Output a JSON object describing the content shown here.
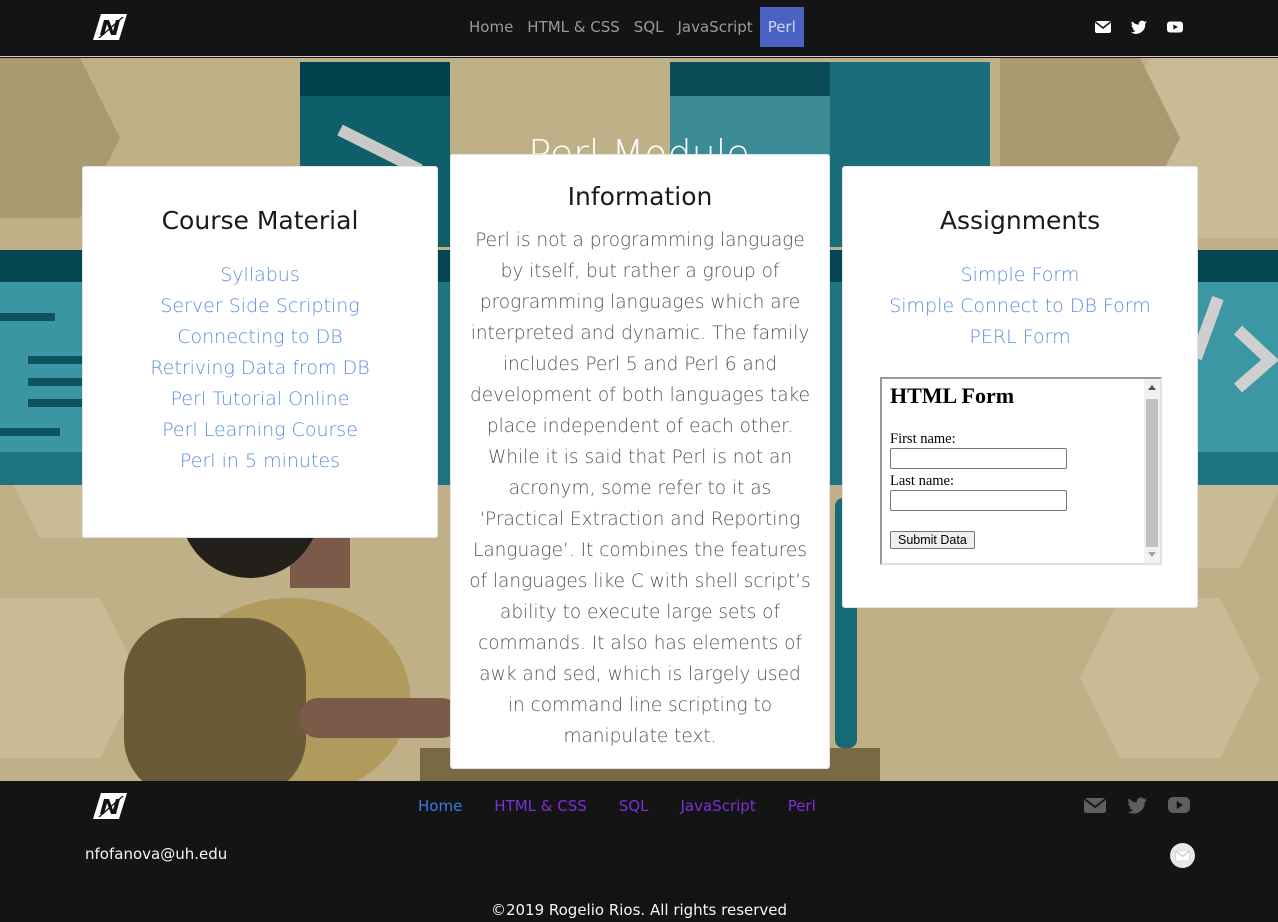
{
  "nav": {
    "logo_icon": "n-slash-logo-icon",
    "links": [
      "Home",
      "HTML & CSS",
      "SQL",
      "JavaScript",
      "Perl"
    ],
    "active": "Perl",
    "social_icons": [
      "envelope-icon",
      "twitter-icon",
      "youtube-icon"
    ]
  },
  "hero": {
    "title": "Perl Module"
  },
  "course_material": {
    "title": "Course Material",
    "links": [
      "Syllabus",
      "Server Side Scripting",
      "Connecting to DB",
      "Retriving Data from DB",
      "Perl Tutorial Online",
      "Perl Learning Course",
      "Perl in 5 minutes"
    ]
  },
  "information": {
    "title": "Information",
    "text": "Perl is not a programming language by itself, but rather a group of programming languages which are interpreted and dynamic. The family includes Perl 5 and Perl 6 and development of both languages take place independent of each other. While it is said that Perl is not an acronym, some refer to it as ‘Practical Extraction and Reporting Language’. It combines the features of languages like C with shell script’s ability to execute large sets of commands. It also has elements of awk and sed, which is largely used in command line scripting to manipulate text."
  },
  "assignments": {
    "title": "Assignments",
    "links": [
      "Simple Form",
      "Simple Connect to DB Form",
      "PERL Form"
    ],
    "form": {
      "heading": "HTML Form",
      "first_name_label": "First name:",
      "first_name_value": "",
      "last_name_label": "Last name:",
      "last_name_value": "",
      "submit_label": "Submit Data"
    }
  },
  "footer": {
    "links": [
      "Home",
      "HTML & CSS",
      "SQL",
      "JavaScript",
      "Perl"
    ],
    "email": "nfofanova@uh.edu",
    "copyright": "©2019 Rogelio Rios. All rights reserved",
    "social_icons": [
      "envelope-icon",
      "twitter-icon",
      "youtube-icon"
    ]
  },
  "colors": {
    "nav_bg": "#141414",
    "active_link_bg": "#4a62c4",
    "link_blue": "#5b8ee0",
    "visited_link": "#7d2fd8"
  }
}
